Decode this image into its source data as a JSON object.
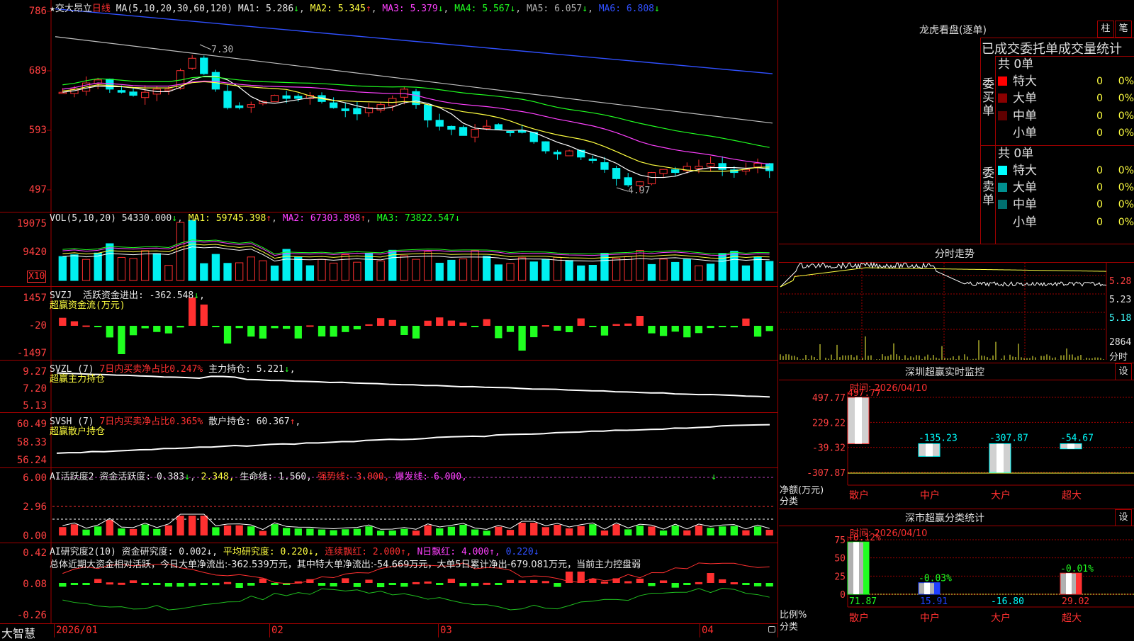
{
  "colors": {
    "up": "#ff3030",
    "down": "#00f0f0",
    "grid": "#a00000",
    "ma1": "#ffffff",
    "ma2": "#ffff40",
    "ma3": "#ff40ff",
    "ma4": "#20ff20",
    "ma5": "#c0c0c0",
    "ma6": "#3050ff"
  },
  "kline": {
    "star": "★",
    "stock_name": "交大昂立",
    "period": "日线",
    "ma_label": "MA(5,10,20,30,60,120)",
    "ma": [
      {
        "name": "MA1:",
        "value": "5.286",
        "arrow": "↓"
      },
      {
        "name": "MA2:",
        "value": "5.345",
        "arrow": "↑"
      },
      {
        "name": "MA3:",
        "value": "5.379",
        "arrow": "↓"
      },
      {
        "name": "MA4:",
        "value": "5.567",
        "arrow": "↓"
      },
      {
        "name": "MA5:",
        "value": "6.057",
        "arrow": "↓"
      },
      {
        "name": "MA6:",
        "value": "6.808",
        "arrow": "↓"
      }
    ],
    "yticks": [
      "786",
      "689",
      "593",
      "497"
    ],
    "high_label": "7.30",
    "low_label": "4.97"
  },
  "vol": {
    "label": "VOL(5,10,20)",
    "value": "54330.000",
    "arrow": "↓",
    "ma": [
      {
        "name": "MA1:",
        "value": "59745.398",
        "arrow": "↑"
      },
      {
        "name": "MA2:",
        "value": "67303.898",
        "arrow": "↑"
      },
      {
        "name": "MA3:",
        "value": "73822.547",
        "arrow": "↓"
      }
    ],
    "yticks": [
      "19075",
      "9420"
    ],
    "unit": "X10"
  },
  "svzj": {
    "label": "SVZJ",
    "line1": "活跃资金进出:",
    "value": "-362.548",
    "arrow": "↓",
    "comma": ",",
    "sub": "超赢资金流(万元)",
    "yticks": [
      "1457",
      "-20",
      "-1497"
    ]
  },
  "svzl": {
    "label": "SVZL (7)",
    "net": "7日内买卖净占比0.247%",
    "holding_label": "主力持仓:",
    "holding": "5.221",
    "arrow": "↓",
    "comma": ",",
    "sub": "超赢主力持仓",
    "yticks": [
      "9.27",
      "7.20",
      "5.13"
    ]
  },
  "svsh": {
    "label": "SVSH (7)",
    "net": "7日内买卖净占比0.365%",
    "holding_label": "散户持仓:",
    "holding": "60.367",
    "arrow": "↑",
    "comma": ",",
    "sub": "超赢散户持仓",
    "yticks": [
      "60.49",
      "58.33",
      "56.24"
    ]
  },
  "ai1": {
    "label": "AI活跃度2",
    "active_label": "资金活跃度:",
    "active": "0.383",
    "arrow": "↓",
    "v2": "2.348,",
    "life": "生命线: 1.560,",
    "strong": "强势线: 3.000,",
    "burst": "爆发线: 6.000,",
    "tail": "↓",
    "yticks": [
      "6.00",
      "2.96",
      "0.00"
    ]
  },
  "ai2": {
    "label": "AI研究度2(10)",
    "research": "资金研究度: 0.002↓,",
    "avg": "平均研究度: 0.220↓,",
    "streak": "连续飘红: 2.000↑,",
    "nred": "N日飘红: 4.000↑,",
    "v": "0.220↓",
    "summary": "总体近期大资金相对活跃，今日大单净流出:-362.539万元，其中特大单净流出:-54.669万元，大单5日累计净出-679.081万元，当前主力控盘弱",
    "yticks": [
      "0.42",
      "0.08",
      "-0.26"
    ]
  },
  "axis": {
    "brand": "大智慧",
    "dates": [
      "2026/01",
      "02",
      "03",
      "04"
    ]
  },
  "longhu": {
    "title": "龙虎看盘(逐单)",
    "btn1": "柱",
    "btn2": "笔",
    "sub": "已成交委托单成交量统计",
    "buy": {
      "total": "共 0单",
      "side": "委买单",
      "rows": [
        {
          "name": "特大",
          "vol": "0",
          "pct": "0%",
          "color": "#ff0000"
        },
        {
          "name": "大单",
          "vol": "0",
          "pct": "0%",
          "color": "#8a0000"
        },
        {
          "name": "中单",
          "vol": "0",
          "pct": "0%",
          "color": "#600000"
        },
        {
          "name": "小单",
          "vol": "0",
          "pct": "0%",
          "color": "#000000"
        }
      ]
    },
    "sell": {
      "total": "共 0单",
      "side": "委卖单",
      "rows": [
        {
          "name": "特大",
          "vol": "0",
          "pct": "0%",
          "color": "#00ffff"
        },
        {
          "name": "大单",
          "vol": "0",
          "pct": "0%",
          "color": "#009090"
        },
        {
          "name": "中单",
          "vol": "0",
          "pct": "0%",
          "color": "#007070"
        },
        {
          "name": "小单",
          "vol": "0",
          "pct": "0%",
          "color": "#000000"
        }
      ]
    }
  },
  "intraday": {
    "title": "分时走势",
    "yticks": [
      "5.28",
      "5.23",
      "5.18"
    ],
    "vol_top": "2864",
    "vol_unit": "分时"
  },
  "monitor": {
    "title": "深圳超赢实时监控",
    "settings": "设",
    "time": "时间: 2026/04/10",
    "yticks": [
      "497.77",
      "229.22",
      "-39.32",
      "-307.87"
    ],
    "ylabel1": "净额(万元)",
    "ylabel2": "分类",
    "bars": [
      {
        "cat": "散户",
        "value": "497.77",
        "num": 497.77
      },
      {
        "cat": "中户",
        "value": "-135.23",
        "num": -135.23
      },
      {
        "cat": "大户",
        "value": "-307.87",
        "num": -307.87
      },
      {
        "cat": "超大",
        "value": "-54.67",
        "num": -54.67
      }
    ]
  },
  "classify": {
    "title": "深市超赢分类统计",
    "settings": "设",
    "time": "时间: 2026/04/10",
    "yticks": [
      "75",
      "50",
      "25",
      "0"
    ],
    "ylabel1": "比例%",
    "ylabel2": "分类",
    "bars": [
      {
        "cat": "散户",
        "top": "+0.12%",
        "bottom": "71.87",
        "num": 71.87,
        "color": "#20ff20"
      },
      {
        "cat": "中户",
        "top": "-0.03%",
        "bottom": "15.91",
        "num": 15.91,
        "color": "#2040ff"
      },
      {
        "cat": "大户",
        "top": "",
        "bottom": "-16.80",
        "num": 0,
        "color": "#00ffff"
      },
      {
        "cat": "超大",
        "top": "-0.01%",
        "bottom": "29.02",
        "num": 29.02,
        "color": "#ff3030"
      }
    ]
  }
}
